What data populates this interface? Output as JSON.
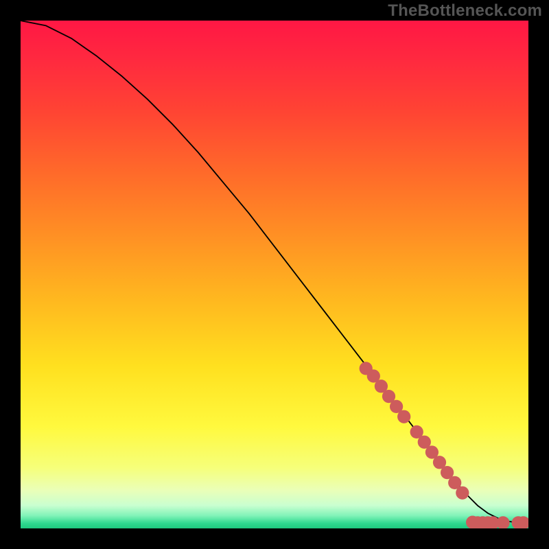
{
  "watermark": "TheBottleneck.com",
  "colors": {
    "page_bg": "#000000",
    "line": "#000000",
    "dot_fill": "#cd5c5c",
    "gradient_stops": [
      {
        "offset": 0.0,
        "color": "#ff1744"
      },
      {
        "offset": 0.08,
        "color": "#ff2a3f"
      },
      {
        "offset": 0.18,
        "color": "#ff4433"
      },
      {
        "offset": 0.3,
        "color": "#ff6a2a"
      },
      {
        "offset": 0.42,
        "color": "#ff8f24"
      },
      {
        "offset": 0.55,
        "color": "#ffb81f"
      },
      {
        "offset": 0.68,
        "color": "#ffe01f"
      },
      {
        "offset": 0.8,
        "color": "#fff93e"
      },
      {
        "offset": 0.88,
        "color": "#f6ff7a"
      },
      {
        "offset": 0.925,
        "color": "#eaffb8"
      },
      {
        "offset": 0.955,
        "color": "#c9ffd0"
      },
      {
        "offset": 0.975,
        "color": "#80f3b8"
      },
      {
        "offset": 0.99,
        "color": "#2fd98f"
      },
      {
        "offset": 1.0,
        "color": "#1fc97f"
      }
    ]
  },
  "chart_data": {
    "type": "line",
    "title": "",
    "xlabel": "",
    "ylabel": "",
    "xlim": [
      0,
      100
    ],
    "ylim": [
      0,
      100
    ],
    "series": [
      {
        "name": "curve",
        "x": [
          0,
          5,
          10,
          15,
          20,
          25,
          30,
          35,
          40,
          45,
          50,
          55,
          60,
          65,
          70,
          75,
          80,
          85,
          88,
          90,
          92,
          94,
          96,
          98,
          100
        ],
        "y": [
          100,
          99,
          96.5,
          93,
          89,
          84.5,
          79.5,
          74,
          68,
          62,
          55.5,
          49,
          42.5,
          36,
          29.5,
          23,
          16.5,
          10,
          6.5,
          4.5,
          3.0,
          2.0,
          1.4,
          1.1,
          1.0
        ]
      }
    ],
    "dots": {
      "name": "highlight-dots",
      "points": [
        {
          "x": 68,
          "y": 31.5
        },
        {
          "x": 69.5,
          "y": 30
        },
        {
          "x": 71,
          "y": 28
        },
        {
          "x": 72.5,
          "y": 26
        },
        {
          "x": 74,
          "y": 24
        },
        {
          "x": 75.5,
          "y": 22
        },
        {
          "x": 78,
          "y": 19
        },
        {
          "x": 79.5,
          "y": 17
        },
        {
          "x": 81,
          "y": 15
        },
        {
          "x": 82.5,
          "y": 13
        },
        {
          "x": 84,
          "y": 11
        },
        {
          "x": 85.5,
          "y": 9
        },
        {
          "x": 87,
          "y": 7
        },
        {
          "x": 89,
          "y": 1.2
        },
        {
          "x": 90,
          "y": 1.1
        },
        {
          "x": 91,
          "y": 1.1
        },
        {
          "x": 92,
          "y": 1.1
        },
        {
          "x": 93,
          "y": 1.1
        },
        {
          "x": 95,
          "y": 1.1
        },
        {
          "x": 98,
          "y": 1.1
        },
        {
          "x": 99,
          "y": 1.1
        }
      ],
      "radius": 1.3
    }
  }
}
